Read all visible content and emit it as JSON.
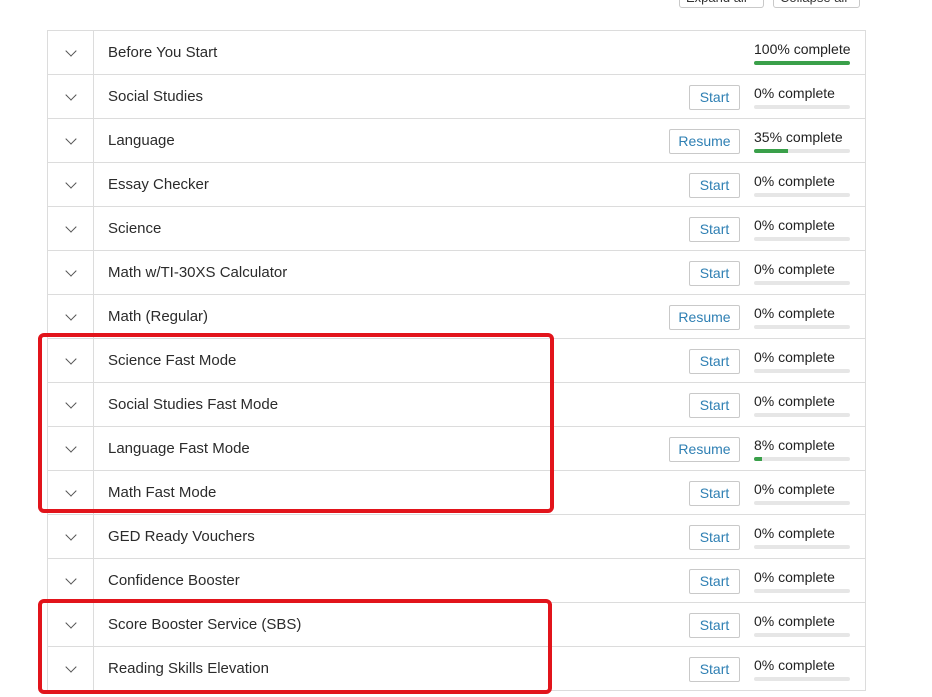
{
  "toolbar": {
    "expand_all_label": "Expand all",
    "collapse_all_label": "Collapse all"
  },
  "modules": [
    {
      "title": "Before You Start",
      "action": "",
      "progress_text": "100% complete",
      "progress": 100
    },
    {
      "title": "Social Studies",
      "action": "Start",
      "progress_text": "0% complete",
      "progress": 0
    },
    {
      "title": "Language",
      "action": "Resume",
      "progress_text": "35% complete",
      "progress": 35
    },
    {
      "title": "Essay Checker",
      "action": "Start",
      "progress_text": "0% complete",
      "progress": 0
    },
    {
      "title": "Science",
      "action": "Start",
      "progress_text": "0% complete",
      "progress": 0
    },
    {
      "title": "Math w/TI-30XS Calculator",
      "action": "Start",
      "progress_text": "0% complete",
      "progress": 0
    },
    {
      "title": "Math (Regular)",
      "action": "Resume",
      "progress_text": "0% complete",
      "progress": 0
    },
    {
      "title": "Science Fast Mode",
      "action": "Start",
      "progress_text": "0% complete",
      "progress": 0
    },
    {
      "title": "Social Studies Fast Mode",
      "action": "Start",
      "progress_text": "0% complete",
      "progress": 0
    },
    {
      "title": "Language Fast Mode",
      "action": "Resume",
      "progress_text": "8% complete",
      "progress": 8
    },
    {
      "title": "Math Fast Mode",
      "action": "Start",
      "progress_text": "0% complete",
      "progress": 0
    },
    {
      "title": "GED Ready Vouchers",
      "action": "Start",
      "progress_text": "0% complete",
      "progress": 0
    },
    {
      "title": "Confidence Booster",
      "action": "Start",
      "progress_text": "0% complete",
      "progress": 0
    },
    {
      "title": "Score Booster Service (SBS)",
      "action": "Start",
      "progress_text": "0% complete",
      "progress": 0
    },
    {
      "title": "Reading Skills Elevation",
      "action": "Start",
      "progress_text": "0% complete",
      "progress": 0
    }
  ],
  "colors": {
    "progress_fill": "#3aa04a",
    "progress_track": "#e6e6e6",
    "button_text": "#2e7fb3",
    "highlight": "#e2141b"
  },
  "icons": {
    "row_toggle": "chevron-down-icon"
  }
}
